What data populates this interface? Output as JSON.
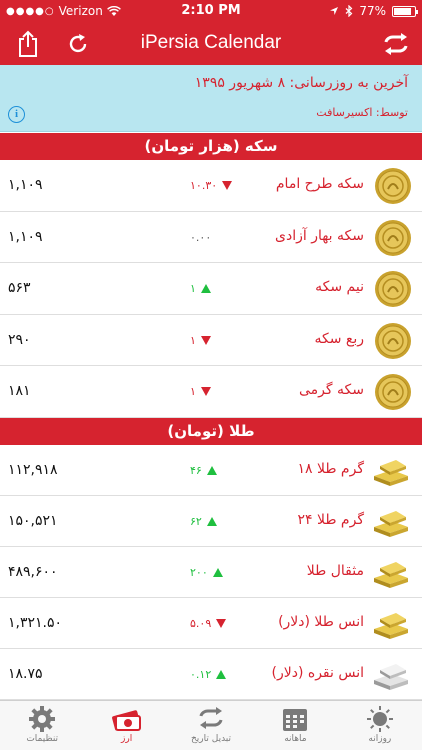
{
  "status_bar": {
    "carrier": "Verizon",
    "time": "2:10 PM",
    "battery": "77%"
  },
  "app": {
    "title": "iPersia Calendar"
  },
  "banner": {
    "line1": "آخرین به روزرسانی: ۸ شهریور ۱۳۹۵",
    "line2": "توسط: اکسیرسافت"
  },
  "coin_section": {
    "title": "سکه (هزار تومان)",
    "rows": [
      {
        "name": "سکه طرح امام",
        "change": "۱۰.۳۰",
        "direction": "down",
        "value": "۱,۱۰۹"
      },
      {
        "name": "سکه بهار آزادی",
        "change": "۰.۰۰",
        "direction": "flat",
        "value": "۱,۱۰۹"
      },
      {
        "name": "نیم سکه",
        "change": "۱",
        "direction": "up",
        "value": "۵۶۳"
      },
      {
        "name": "ربع سکه",
        "change": "۱",
        "direction": "down",
        "value": "۲۹۰"
      },
      {
        "name": "سکه گرمی",
        "change": "۱",
        "direction": "down",
        "value": "۱۸۱"
      }
    ]
  },
  "gold_section": {
    "title": "طلا (تومان)",
    "rows": [
      {
        "name": "گرم طلا ۱۸",
        "change": "۴۶",
        "direction": "up",
        "value": "۱۱۲,۹۱۸"
      },
      {
        "name": "گرم طلا ۲۴",
        "change": "۶۲",
        "direction": "up",
        "value": "۱۵۰,۵۲۱"
      },
      {
        "name": "مثقال طلا",
        "change": "۲۰۰",
        "direction": "up",
        "value": "۴۸۹,۶۰۰"
      },
      {
        "name": "انس طلا (دلار)",
        "change": "۵.۰۹",
        "direction": "down",
        "value": "۱,۳۲۱.۵۰"
      },
      {
        "name": "انس نقره (دلار)",
        "change": "۰.۱۲",
        "direction": "up",
        "value": "۱۸.۷۵"
      }
    ]
  },
  "tabs": [
    {
      "label": "تنظیمات",
      "icon": "gear-icon"
    },
    {
      "label": "ارز",
      "icon": "currency-icon",
      "active": true
    },
    {
      "label": "تبدیل تاریخ",
      "icon": "convert-icon"
    },
    {
      "label": "ماهانه",
      "icon": "calendar-icon"
    },
    {
      "label": "روزانه",
      "icon": "sun-icon"
    }
  ],
  "colors": {
    "primary": "#d6232f",
    "banner_bg": "#b8e6f0",
    "up": "#1fbf3f",
    "down": "#d6232f",
    "gold": "#d4b13c"
  }
}
